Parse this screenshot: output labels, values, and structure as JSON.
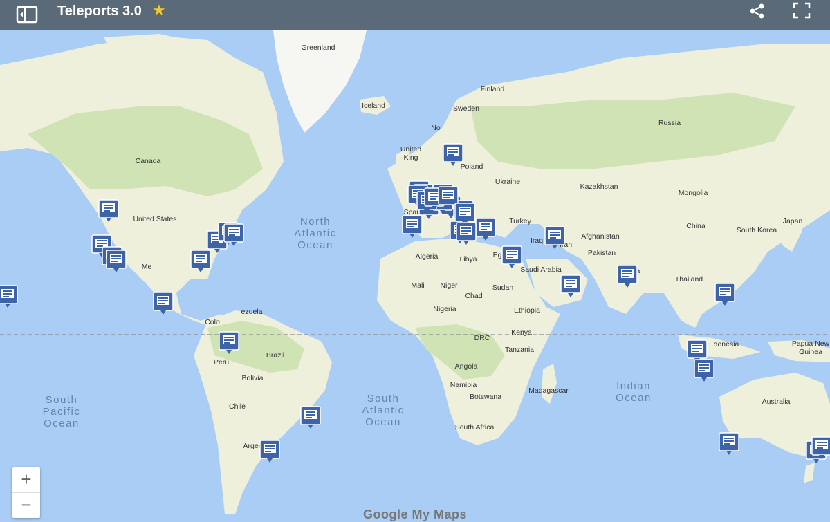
{
  "app": {
    "title": "Teleports 3.0",
    "star": "★",
    "icons": {
      "panel": "side-panel-icon",
      "share": "share-icon",
      "fullscreen": "fullscreen-icon"
    }
  },
  "map": {
    "ocean_color": "#a9cdf5",
    "land_color": "#eef0dc",
    "forest_color": "#cfe3b4",
    "ice_color": "#f6f6f2",
    "equator_color": "#8a8a8a",
    "labels": {
      "greenland": "Greenland",
      "iceland": "Iceland",
      "finland": "Finland",
      "sweden": "Sweden",
      "norway": "No",
      "united_kingdom": "United\nKing",
      "poland": "Poland",
      "ukraine": "Ukraine",
      "russia": "Russia",
      "kazakhstan": "Kazakhstan",
      "mongolia": "Mongolia",
      "china": "China",
      "south_korea": "South Korea",
      "japan": "Japan",
      "canada": "Canada",
      "united_states": "United States",
      "mexico": "Me",
      "north_atlantic": "North\nAtlantic\nOcean",
      "turkey": "Turkey",
      "iraq": "Iraq",
      "iran": "Iran",
      "afghanistan": "Afghanistan",
      "pakistan": "Pakistan",
      "india": "India",
      "thailand": "Thailand",
      "saudi_arabia": "Saudi Arabia",
      "egypt": "Egypt",
      "libya": "Libya",
      "algeria": "Algeria",
      "mali": "Mali",
      "niger": "Niger",
      "chad": "Chad",
      "sudan": "Sudan",
      "nigeria": "Nigeria",
      "ethiopia": "Ethiopia",
      "drc": "DRC",
      "kenya": "Kenya",
      "tanzania": "Tanzania",
      "angola": "Angola",
      "namibia": "Namibia",
      "botswana": "Botswana",
      "madagascar": "Madagascar",
      "south_africa": "South Africa",
      "venezuela": "ezuela",
      "colombia": "Colo",
      "peru": "Peru",
      "brazil": "Brazil",
      "bolivia": "Bolivia",
      "chile": "Chile",
      "argentina": "Argentina",
      "spain": "Spain",
      "indonesia": "donesia",
      "papua": "Papua New\nGuinea",
      "australia": "Australia",
      "south_pacific": "South\nPacific\nOcean",
      "south_atlantic": "South\nAtlantic\nOcean",
      "indian_ocean": "Indian\nOcean"
    },
    "marker_icon": "satellite-dish-marker-icon",
    "marker_count": 41
  },
  "controls": {
    "zoom_in": "+",
    "zoom_out": "−"
  },
  "footer": {
    "brand": "Google My Maps"
  }
}
